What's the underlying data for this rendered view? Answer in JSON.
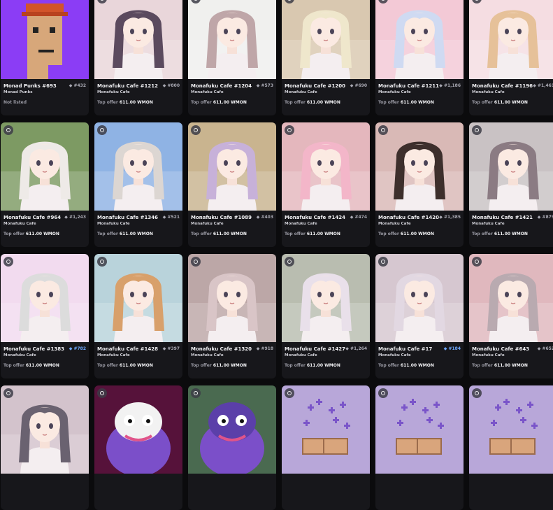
{
  "cards": [
    {
      "name": "Monad Punks #693",
      "rank": "#432",
      "collection": "Monad Punks",
      "offer_label": "Not listed",
      "offer_value": "",
      "img": "punk",
      "bg": "#8b3df5",
      "highlight": false
    },
    {
      "name": "Monafuku Cafe #1212",
      "rank": "#800",
      "collection": "Monafuku Cafe",
      "offer_label": "Top offer",
      "offer_value": "611.00 WMON",
      "img": "anime",
      "bg": "#e9d6da",
      "hair": "#5b4a5e",
      "highlight": false
    },
    {
      "name": "Monafuku Cafe #1204",
      "rank": "#573",
      "collection": "Monafuku Cafe",
      "offer_label": "Top offer",
      "offer_value": "611.00 WMON",
      "img": "anime",
      "bg": "#f0f0ee",
      "hair": "#bfa6a8",
      "highlight": false
    },
    {
      "name": "Monafuku Cafe #1200",
      "rank": "#690",
      "collection": "Monafuku Cafe",
      "offer_label": "Top offer",
      "offer_value": "611.00 WMON",
      "img": "anime",
      "bg": "#d9c8b0",
      "hair": "#efe7cc",
      "highlight": false
    },
    {
      "name": "Monafuku Cafe #1211",
      "rank": "#1,186",
      "collection": "Monafuku Cafe",
      "offer_label": "Top offer",
      "offer_value": "611.00 WMON",
      "img": "anime",
      "bg": "#f3c9d6",
      "hair": "#cfdaf2",
      "highlight": false
    },
    {
      "name": "Monafuku Cafe #1196",
      "rank": "#1,461",
      "collection": "Monafuku Cafe",
      "offer_label": "Top offer",
      "offer_value": "611.00 WMON",
      "img": "anime",
      "bg": "#f5dde2",
      "hair": "#e6c199",
      "highlight": false
    },
    {
      "name": "Monafuku Cafe #964",
      "rank": "#1,243",
      "collection": "Monafuku Cafe",
      "offer_label": "Top offer",
      "offer_value": "611.00 WMON",
      "img": "anime",
      "bg": "#7d9a63",
      "hair": "#eeeae7",
      "highlight": false
    },
    {
      "name": "Monafuku Cafe #1346",
      "rank": "#521",
      "collection": "Monafuku Cafe",
      "offer_label": "Top offer",
      "offer_value": "611.00 WMON",
      "img": "anime",
      "bg": "#8fb3e4",
      "hair": "#dcd6d2",
      "highlight": false
    },
    {
      "name": "Monafuku Cafe #1089",
      "rank": "#403",
      "collection": "Monafuku Cafe",
      "offer_label": "Top offer",
      "offer_value": "611.00 WMON",
      "img": "anime",
      "bg": "#c9b48f",
      "hair": "#c7b1d9",
      "highlight": false
    },
    {
      "name": "Monafuku Cafe #1424",
      "rank": "#474",
      "collection": "Monafuku Cafe",
      "offer_label": "Top offer",
      "offer_value": "611.00 WMON",
      "img": "anime",
      "bg": "#e4b7bd",
      "hair": "#f3b6c9",
      "highlight": false
    },
    {
      "name": "Monafuku Cafe #1420",
      "rank": "#1,385",
      "collection": "Monafuku Cafe",
      "offer_label": "Top offer",
      "offer_value": "611.00 WMON",
      "img": "anime",
      "bg": "#d9b9b6",
      "hair": "#3d2f2c",
      "highlight": false
    },
    {
      "name": "Monafuku Cafe #1421",
      "rank": "#879",
      "collection": "Monafuku Cafe",
      "offer_label": "Top offer",
      "offer_value": "611.00 WMON",
      "img": "anime",
      "bg": "#c9c2c4",
      "hair": "#8b7b83",
      "highlight": false
    },
    {
      "name": "Monafuku Cafe #1383",
      "rank": "#782",
      "collection": "Monafuku Cafe",
      "offer_label": "Top offer",
      "offer_value": "611.00 WMON",
      "img": "anime",
      "bg": "#f2dbef",
      "hair": "#dcdcdc",
      "highlight": true
    },
    {
      "name": "Monafuku Cafe #1428",
      "rank": "#397",
      "collection": "Monafuku Cafe",
      "offer_label": "Top offer",
      "offer_value": "611.00 WMON",
      "img": "anime",
      "bg": "#b9d3db",
      "hair": "#d8a06b",
      "highlight": false
    },
    {
      "name": "Monafuku Cafe #1320",
      "rank": "#918",
      "collection": "Monafuku Cafe",
      "offer_label": "Top offer",
      "offer_value": "611.00 WMON",
      "img": "anime",
      "bg": "#bca7a7",
      "hair": "#d9c5c7",
      "highlight": false
    },
    {
      "name": "Monafuku Cafe #1427",
      "rank": "#1,264",
      "collection": "Monafuku Cafe",
      "offer_label": "Top offer",
      "offer_value": "611.00 WMON",
      "img": "anime",
      "bg": "#b9bdb0",
      "hair": "#e9e0ea",
      "highlight": false
    },
    {
      "name": "Monafuku Cafe #17",
      "rank": "#184",
      "collection": "Monafuku Cafe",
      "offer_label": "Top offer",
      "offer_value": "611.00 WMON",
      "img": "anime",
      "bg": "#d6c7d0",
      "hair": "#e2d8e2",
      "highlight": true
    },
    {
      "name": "Monafuku Cafe #643",
      "rank": "#652",
      "collection": "Monafuku Cafe",
      "offer_label": "Top offer",
      "offer_value": "611.00 WMON",
      "img": "anime",
      "bg": "#e0b8be",
      "hair": "#b9aab0",
      "highlight": false
    },
    {
      "name": "",
      "rank": "",
      "collection": "",
      "offer_label": "",
      "offer_value": "",
      "img": "anime",
      "bg": "#d3c3cc",
      "hair": "#6a6270",
      "highlight": false
    },
    {
      "name": "",
      "rank": "",
      "collection": "",
      "offer_label": "",
      "offer_value": "",
      "img": "frog",
      "bg": "#56123a",
      "highlight": false
    },
    {
      "name": "",
      "rank": "",
      "collection": "",
      "offer_label": "",
      "offer_value": "",
      "img": "frog2",
      "bg": "#4a6a50",
      "highlight": false
    },
    {
      "name": "",
      "rank": "",
      "collection": "",
      "offer_label": "",
      "offer_value": "",
      "img": "pixel",
      "bg": "#b8a7d9",
      "highlight": false
    },
    {
      "name": "",
      "rank": "",
      "collection": "",
      "offer_label": "",
      "offer_value": "",
      "img": "pixel",
      "bg": "#b8a7d9",
      "highlight": false
    },
    {
      "name": "",
      "rank": "",
      "collection": "",
      "offer_label": "",
      "offer_value": "",
      "img": "pixel",
      "bg": "#b8a7d9",
      "highlight": false
    }
  ]
}
